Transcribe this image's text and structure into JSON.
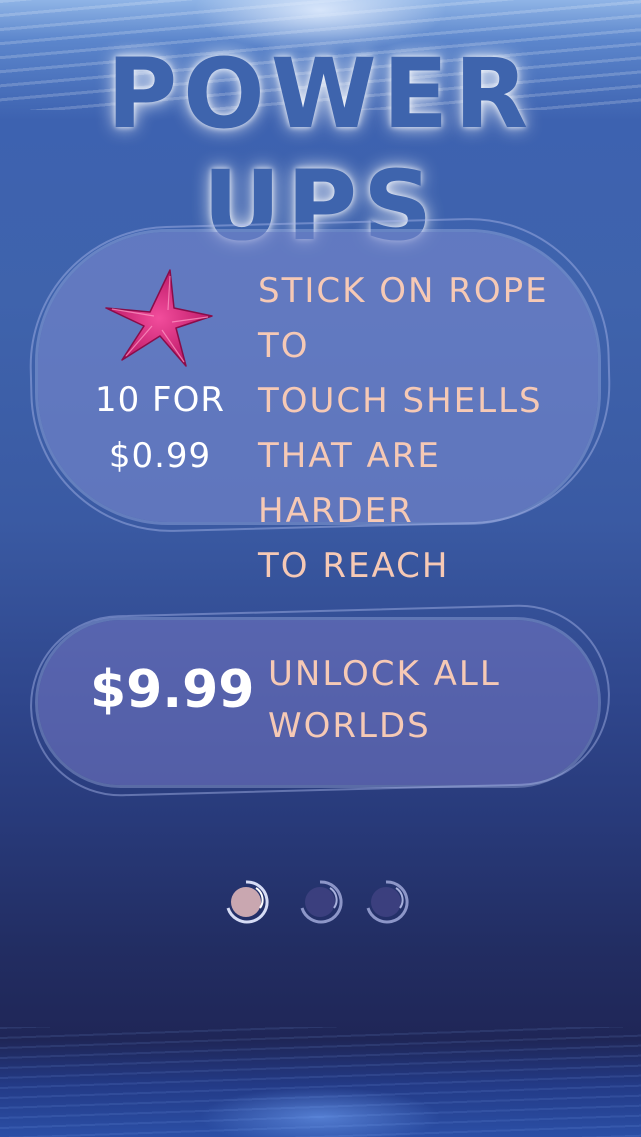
{
  "screen": {
    "title": "POWER UPS"
  },
  "offers": [
    {
      "icon": "starfish-icon",
      "quantity_line": "10 FOR",
      "price": "$0.99",
      "description_lines": [
        "STICK ON ROPE TO",
        "TOUCH SHELLS",
        "THAT ARE HARDER",
        "TO REACH"
      ]
    },
    {
      "price": "$9.99",
      "description_lines": [
        "UNLOCK ALL",
        "WORLDS"
      ]
    }
  ],
  "pagination": {
    "pages": 3,
    "current_page": 1
  },
  "colors": {
    "title": "#3e64ad",
    "description": "#f6c9b5",
    "price": "#ffffff",
    "starfish": "#e0207a"
  }
}
